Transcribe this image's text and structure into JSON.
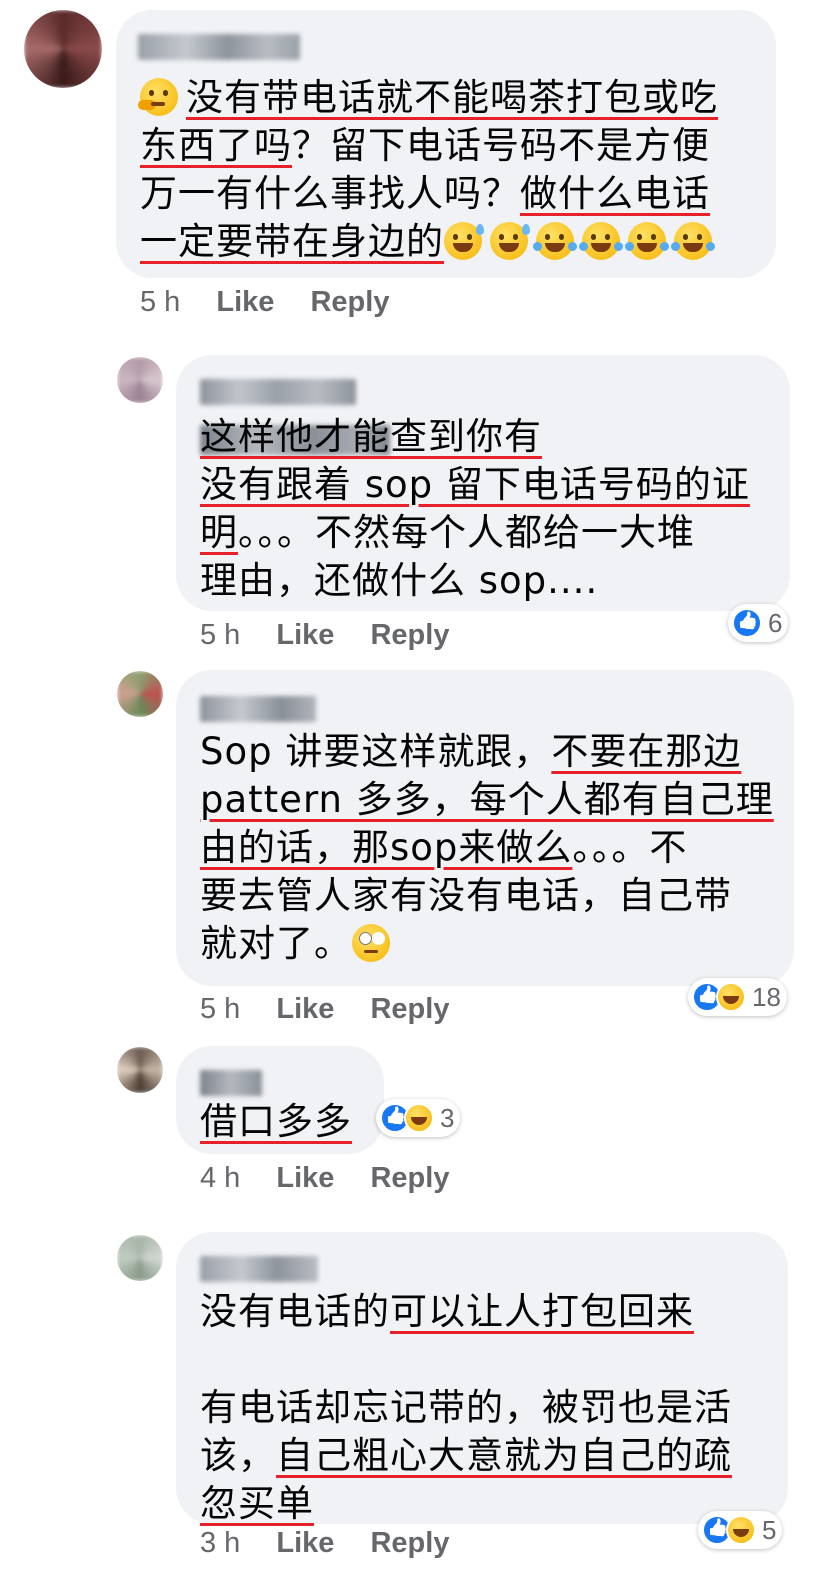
{
  "comments": [
    {
      "lines": [
        [
          {
            "t": "🤔",
            "emoji": "think"
          },
          {
            "t": "没有带电话就不能喝茶打包或吃",
            "u": true
          }
        ],
        [
          {
            "t": "东西了吗",
            "u": true
          },
          {
            "t": "？留下电话号码不是方便"
          }
        ],
        [
          {
            "t": "万一有什么事找人吗？"
          },
          {
            "t": "做什么电话",
            "u": true
          }
        ],
        [
          {
            "t": "一定要带在身边的",
            "u": true
          },
          {
            "t": "😅",
            "emoji": "sweat"
          },
          {
            "t": "😅",
            "emoji": "sweat"
          },
          {
            "t": "😂",
            "emoji": "laugh"
          },
          {
            "t": "😂",
            "emoji": "laugh"
          },
          {
            "t": "😂",
            "emoji": "laugh"
          },
          {
            "t": "😂",
            "emoji": "laugh"
          }
        ]
      ],
      "time": "5 h",
      "like": "Like",
      "reply": "Reply"
    },
    {
      "lines": [
        [
          {
            "t": "这样他才能查到你有",
            "u": true
          }
        ],
        [
          {
            "t": "没有跟着 sop 留下电话号码的证",
            "u": true
          }
        ],
        [
          {
            "t": "明",
            "u": true
          },
          {
            "t": "。。。不然每个人都给一大堆"
          }
        ],
        [
          {
            "t": "理由，还做什么 sop...."
          }
        ]
      ],
      "time": "5 h",
      "like": "Like",
      "reply": "Reply",
      "reaction_count": "6"
    },
    {
      "lines": [
        [
          {
            "t": "Sop 讲要这样就跟，"
          },
          {
            "t": "不要在那边",
            "u": true
          }
        ],
        [
          {
            "t": "pattern 多多，每个人都有自己理",
            "u": true
          }
        ],
        [
          {
            "t": "由的话，那sop来做么",
            "u": true
          },
          {
            "t": "。。。不"
          }
        ],
        [
          {
            "t": "要去管人家有没有电话，自己带"
          }
        ],
        [
          {
            "t": "就对了。"
          },
          {
            "t": "🙄",
            "emoji": "roll"
          }
        ]
      ],
      "time": "5 h",
      "like": "Like",
      "reply": "Reply",
      "reaction_count": "18"
    },
    {
      "lines": [
        [
          {
            "t": "借口多多",
            "u": true
          }
        ]
      ],
      "time": "4 h",
      "like": "Like",
      "reply": "Reply",
      "reaction_count": "3"
    },
    {
      "lines": [
        [
          {
            "t": "没有电话的"
          },
          {
            "t": "可以让人打包回来",
            "u": true
          }
        ],
        [
          {
            "t": ""
          }
        ],
        [
          {
            "t": "有电话却忘记带的，被罚也是活"
          }
        ],
        [
          {
            "t": "该，"
          },
          {
            "t": "自己粗心大意就为自己的疏",
            "u": true
          }
        ],
        [
          {
            "t": "忽买单",
            "u": true
          }
        ]
      ],
      "time": "3 h",
      "like": "Like",
      "reply": "Reply",
      "reaction_count": "5"
    }
  ]
}
